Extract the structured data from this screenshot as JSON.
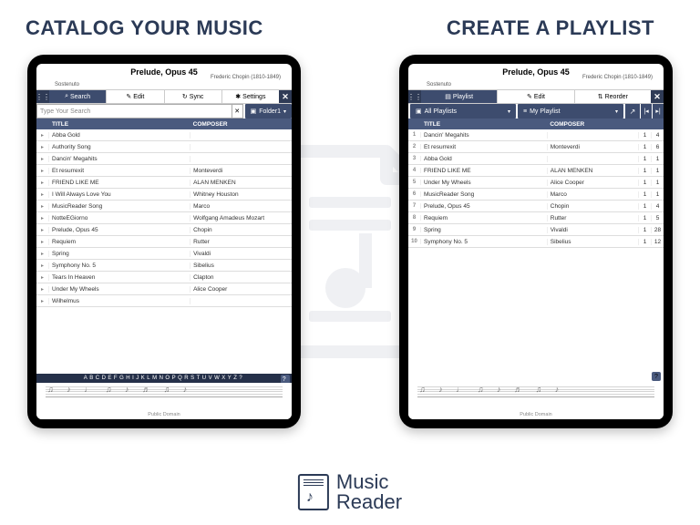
{
  "headlines": {
    "left": "CATALOG YOUR MUSIC",
    "right": "CREATE A PLAYLIST"
  },
  "sheet": {
    "title": "Prelude, Opus 45",
    "composer": "Frederic Chopin (1810-1849)",
    "tempo": "Sostenuto",
    "footer": "Public Domain"
  },
  "catalog": {
    "tabs": {
      "search": "Search",
      "edit": "Edit",
      "sync": "Sync",
      "settings": "Settings"
    },
    "search_placeholder": "Type Your Search",
    "folder": "Folder1",
    "columns": {
      "title": "TITLE",
      "composer": "COMPOSER"
    },
    "rows": [
      {
        "title": "Abba Gold",
        "composer": ""
      },
      {
        "title": "Authority Song",
        "composer": ""
      },
      {
        "title": "Dancin' Megahits",
        "composer": ""
      },
      {
        "title": "Et resurrexit",
        "composer": "Monteverdi"
      },
      {
        "title": "FRIEND LIKE ME",
        "composer": "ALAN MENKEN"
      },
      {
        "title": "I Will Always Love You",
        "composer": "Whitney Houston"
      },
      {
        "title": "MusicReader Song",
        "composer": "Marco"
      },
      {
        "title": "NotteEGiorno",
        "composer": "Wolfgang Amadeus Mozart"
      },
      {
        "title": "Prelude, Opus 45",
        "composer": "Chopin"
      },
      {
        "title": "Requiem",
        "composer": "Rutter"
      },
      {
        "title": "Spring",
        "composer": "Vivaldi"
      },
      {
        "title": "Symphony No. 5",
        "composer": "Sibelius"
      },
      {
        "title": "Tears In Heaven",
        "composer": "Clapton"
      },
      {
        "title": "Under My Wheels",
        "composer": "Alice Cooper"
      },
      {
        "title": "Wilhelmus",
        "composer": ""
      }
    ],
    "alphabet": "ABCDEFGHIJKLMNOPQRSTUVWXYZ?"
  },
  "playlist": {
    "tabs": {
      "playlist": "Playlist",
      "edit": "Edit",
      "reorder": "Reorder"
    },
    "all": "All Playlists",
    "current": "My Playlist",
    "columns": {
      "title": "TITLE",
      "composer": "COMPOSER"
    },
    "rows": [
      {
        "n": "1",
        "title": "Dancin' Megahits",
        "composer": "",
        "a": "1",
        "b": "4"
      },
      {
        "n": "2",
        "title": "Et resurrexit",
        "composer": "Monteverdi",
        "a": "1",
        "b": "6"
      },
      {
        "n": "3",
        "title": "Abba Gold",
        "composer": "",
        "a": "1",
        "b": "1"
      },
      {
        "n": "4",
        "title": "FRIEND LIKE ME",
        "composer": "ALAN MENKEN",
        "a": "1",
        "b": "1"
      },
      {
        "n": "5",
        "title": "Under My Wheels",
        "composer": "Alice Cooper",
        "a": "1",
        "b": "1"
      },
      {
        "n": "6",
        "title": "MusicReader Song",
        "composer": "Marco",
        "a": "1",
        "b": "1"
      },
      {
        "n": "7",
        "title": "Prelude, Opus 45",
        "composer": "Chopin",
        "a": "1",
        "b": "4"
      },
      {
        "n": "8",
        "title": "Requiem",
        "composer": "Rutter",
        "a": "1",
        "b": "5"
      },
      {
        "n": "9",
        "title": "Spring",
        "composer": "Vivaldi",
        "a": "1",
        "b": "28"
      },
      {
        "n": "10",
        "title": "Symphony No. 5",
        "composer": "Sibelius",
        "a": "1",
        "b": "12"
      }
    ]
  },
  "brand": {
    "l1": "Music",
    "l2": "Reader"
  },
  "help": "?"
}
